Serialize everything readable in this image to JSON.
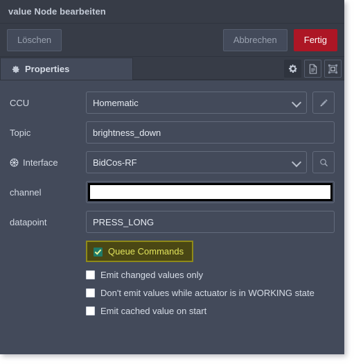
{
  "window": {
    "title": "value Node bearbeiten"
  },
  "toolbar": {
    "delete_label": "Löschen",
    "cancel_label": "Abbrechen",
    "done_label": "Fertig",
    "done_color": "#ad1625"
  },
  "tabs": {
    "properties_label": "Properties",
    "icons": [
      {
        "name": "gear-icon",
        "active": true
      },
      {
        "name": "description-icon",
        "active": false
      },
      {
        "name": "resize-layout-icon",
        "active": false
      }
    ]
  },
  "form": {
    "fields": [
      {
        "label": "CCU",
        "value": "Homematic",
        "type": "select",
        "side_button": "pencil-icon"
      },
      {
        "label": "Topic",
        "value": "brightness_down",
        "type": "text",
        "side_button": null
      },
      {
        "label": "Interface",
        "label_icon": "globe-icon",
        "value": "BidCos-RF",
        "type": "select",
        "side_button": "search-icon"
      },
      {
        "label": "channel",
        "value": "",
        "type": "text",
        "redacted": true,
        "side_button": null
      },
      {
        "label": "datapoint",
        "value": "PRESS_LONG",
        "type": "text",
        "side_button": null
      }
    ],
    "checkboxes": [
      {
        "label": "Queue Commands",
        "checked": true,
        "highlighted": true
      },
      {
        "label": "Emit changed values only",
        "checked": false,
        "highlighted": false
      },
      {
        "label": "Don't emit values while actuator is in WORKING state",
        "checked": false,
        "highlighted": false
      },
      {
        "label": "Emit cached value on start",
        "checked": false,
        "highlighted": false
      }
    ]
  },
  "theme": {
    "background": "#434a5a",
    "chrome": "#373c47",
    "border": "#2f343e",
    "text": "#d7dde7",
    "highlight_bg": "#4a4714",
    "highlight_border": "#8f8a18",
    "highlight_text": "#e2e45c",
    "checkbox_checked": "#1f7a68"
  }
}
